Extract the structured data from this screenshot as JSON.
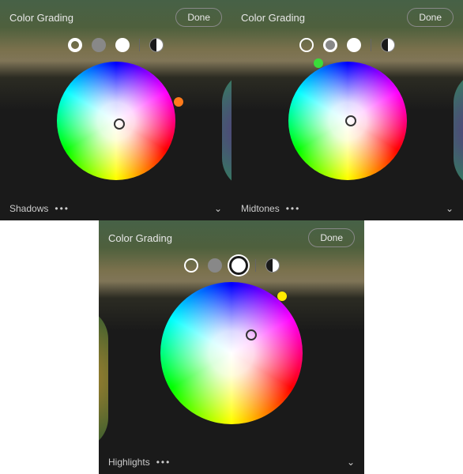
{
  "panels": [
    {
      "title": "Color Grading",
      "done": "Done",
      "section": "Shadows",
      "mode": "shadows",
      "indicator": "#ff7a1a",
      "ind_pos": {
        "t": "45px",
        "l": "148px"
      },
      "ptr_pos": {
        "t": "72px",
        "l": "72px"
      }
    },
    {
      "title": "Color Grading",
      "done": "Done",
      "section": "Midtones",
      "mode": "midtones",
      "indicator": "#3adb3a",
      "ind_pos": {
        "t": "-4px",
        "l": "32px"
      },
      "ptr_pos": {
        "t": "68px",
        "l": "72px"
      }
    },
    {
      "title": "Color Grading",
      "done": "Done",
      "section": "Highlights",
      "mode": "highlights",
      "indicator": "#ffeb00",
      "ind_pos": {
        "t": "12px",
        "l": "148px"
      },
      "ptr_pos": {
        "t": "60px",
        "l": "108px"
      }
    }
  ],
  "glyphs": {
    "dots": "•••",
    "chev": "⌄"
  }
}
